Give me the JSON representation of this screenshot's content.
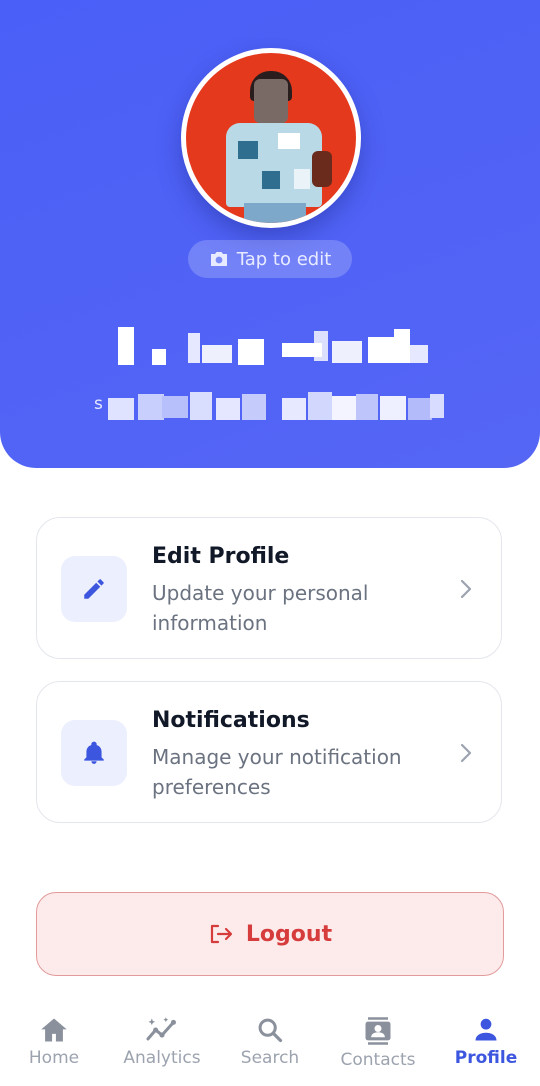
{
  "header": {
    "tap_to_edit_label": "Tap to edit",
    "name_obscured": "",
    "subtitle_letter": "s"
  },
  "menu": [
    {
      "title": "Edit Profile",
      "desc": "Update your personal information",
      "icon": "pencil-icon"
    },
    {
      "title": "Notifications",
      "desc": "Manage your notification preferences",
      "icon": "bell-icon"
    }
  ],
  "logout_label": "Logout",
  "nav": [
    {
      "label": "Home",
      "icon": "home-icon",
      "active": false
    },
    {
      "label": "Analytics",
      "icon": "analytics-icon",
      "active": false
    },
    {
      "label": "Search",
      "icon": "search-icon",
      "active": false
    },
    {
      "label": "Contacts",
      "icon": "contacts-icon",
      "active": false
    },
    {
      "label": "Profile",
      "icon": "person-icon",
      "active": true
    }
  ],
  "colors": {
    "header_bg": "#4a5ff7",
    "accent": "#3d56e0",
    "logout_text": "#d63c3c",
    "logout_bg": "#fdebeb",
    "inactive_nav": "#9ca3af"
  }
}
